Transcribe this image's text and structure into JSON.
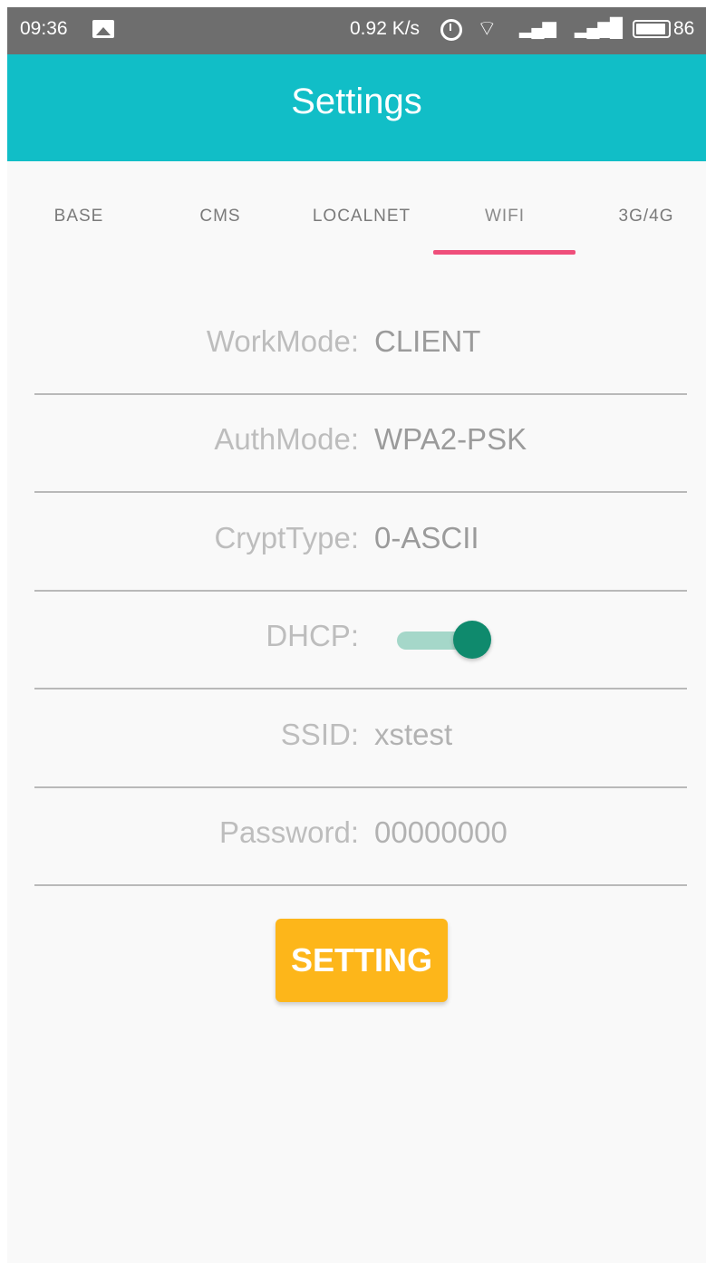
{
  "status_bar": {
    "time": "09:36",
    "speed": "0.92 K/s",
    "battery_pct": "86",
    "icons": [
      "image-icon",
      "alarm-icon",
      "wifi-icon",
      "signal-icon",
      "signal-icon",
      "battery-icon"
    ]
  },
  "app_bar": {
    "title": "Settings",
    "color": "#11bec7"
  },
  "tabs": [
    {
      "label": "BASE"
    },
    {
      "label": "CMS"
    },
    {
      "label": "LOCALNET"
    },
    {
      "label": "WIFI"
    },
    {
      "label": "3G/4G"
    }
  ],
  "active_tab": "WIFI",
  "indicator_color": "#ef4f7b",
  "form": {
    "workmode": {
      "label": "WorkMode:",
      "value": "CLIENT"
    },
    "authmode": {
      "label": "AuthMode:",
      "value": "WPA2-PSK"
    },
    "crypttype": {
      "label": "CryptType:",
      "value": "0-ASCII"
    },
    "dhcp": {
      "label": "DHCP:",
      "enabled": true
    },
    "ssid": {
      "label": "SSID:",
      "value": "xstest"
    },
    "password": {
      "label": "Password:",
      "value": "00000000"
    }
  },
  "button": {
    "label": "SETTING",
    "color": "#fdb61a"
  }
}
